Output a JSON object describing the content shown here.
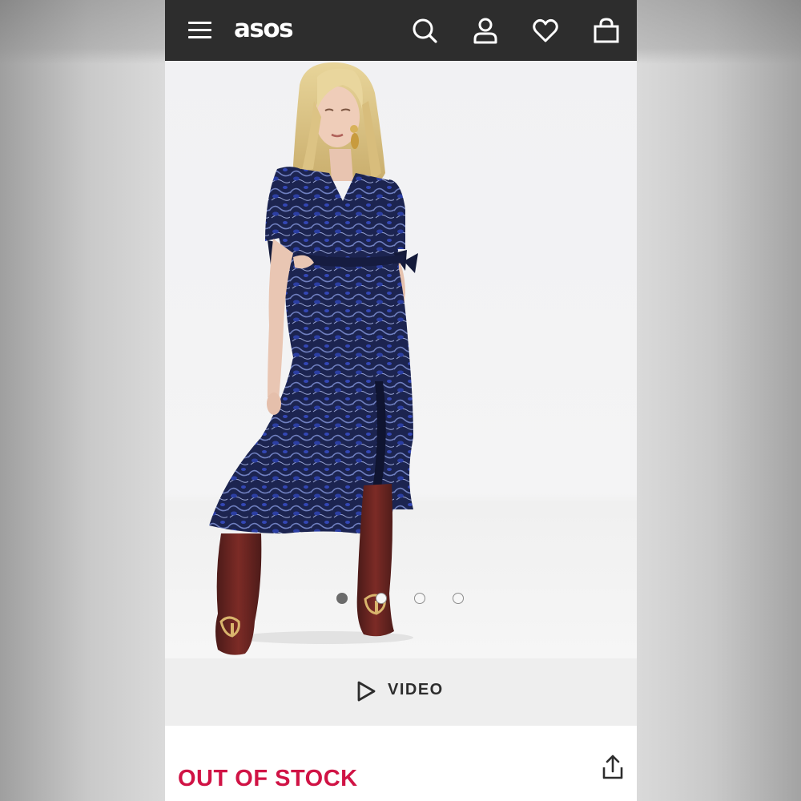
{
  "app": {
    "logo_text": "asos"
  },
  "header": {
    "menu_icon": "hamburger-icon",
    "icons": [
      "search-icon",
      "account-icon",
      "heart-icon",
      "bag-icon"
    ]
  },
  "gallery": {
    "image_description_icon": "product-photo",
    "dots_total": 4,
    "active_dot": 1
  },
  "video": {
    "label": "VIDEO",
    "icon": "play-icon"
  },
  "product": {
    "stock_status": "OUT OF STOCK",
    "share_icon": "share-icon"
  },
  "colors": {
    "header_bg": "#2d2d2d",
    "stock_red": "#d01345",
    "dress_navy": "#1c2450"
  }
}
